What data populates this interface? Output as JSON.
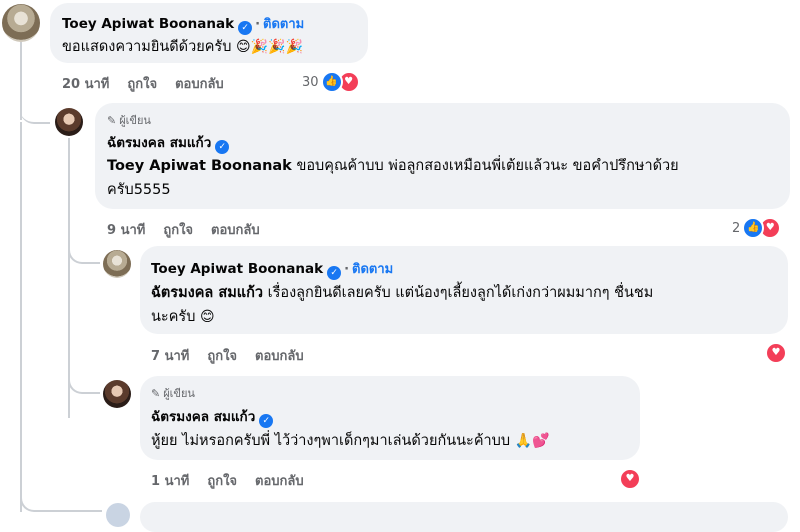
{
  "comments": [
    {
      "name": "Toey Apiwat Boonanak",
      "follow": "ติดตาม",
      "text": "ขอแสดงความยินดีด้วยครับ",
      "emojis": "😊🎉🎉🎉",
      "time": "20 นาที",
      "like": "ถูกใจ",
      "reply": "ตอบกลับ",
      "reaction_count": "30"
    },
    {
      "author_badge": "ผู้เขียน",
      "name": "ฉัตรมงคล สมแก้ว",
      "mention": "Toey Apiwat Boonanak",
      "text_line1": "ขอบคุณค้าบบ พ่อลูกสองเหมือนพี่เต้ยแล้วนะ ขอคำปรึกษาด้วย",
      "text_line2": "ครับ5555",
      "time": "9 นาที",
      "like": "ถูกใจ",
      "reply": "ตอบกลับ",
      "reaction_count": "2"
    },
    {
      "name": "Toey Apiwat Boonanak",
      "follow": "ติดตาม",
      "mention": "ฉัตรมงคล สมแก้ว",
      "text_line1": "เรื่องลูกยินดีเลยครับ แต่น้องๆเลี้ยงลูกได้เก่งกว่าผมมากๆ ชื่นชม",
      "text_line2": "นะครับ",
      "emojis": "😊",
      "time": "7 นาที",
      "like": "ถูกใจ",
      "reply": "ตอบกลับ"
    },
    {
      "author_badge": "ผู้เขียน",
      "name": "ฉัตรมงคล สมแก้ว",
      "text": "หู้ยย ไม่หรอกครับพี่ ไว้ว่างๆพาเด็กๆมาเล่นด้วยกันนะค้าบบ",
      "emojis": "🙏💕",
      "time": "1 นาที",
      "like": "ถูกใจ",
      "reply": "ตอบกลับ"
    }
  ],
  "icons": {
    "like": "thumbs-up-icon",
    "love": "heart-icon",
    "verified": "verified-badge-icon",
    "pen": "pen-icon"
  },
  "colors": {
    "accent": "#1877f2",
    "love": "#f33e58",
    "bubble": "#f0f2f5",
    "muted": "#65676b"
  }
}
